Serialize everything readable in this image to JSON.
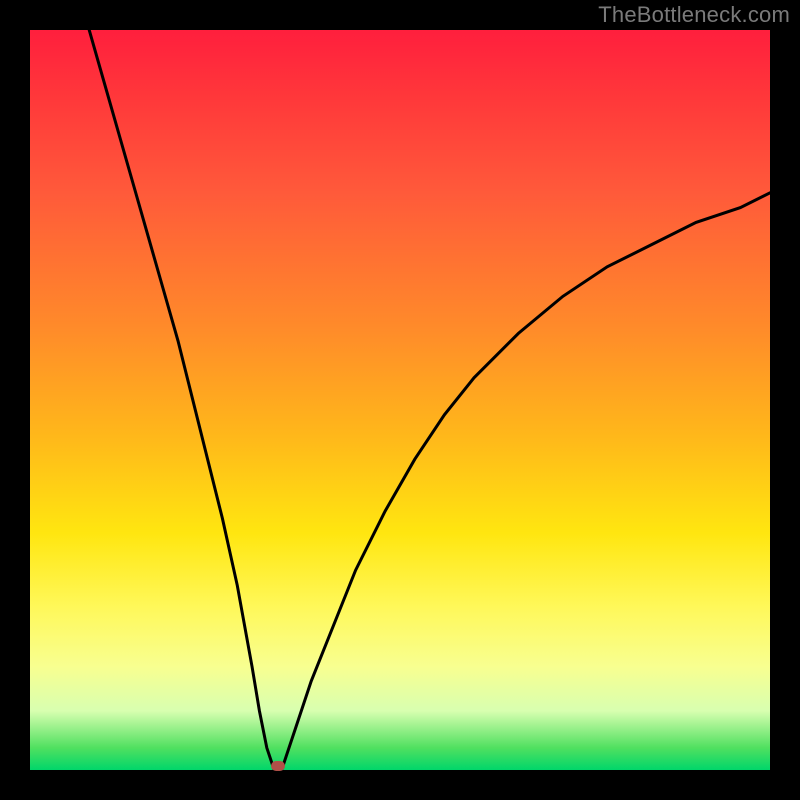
{
  "attribution": "TheBottleneck.com",
  "colors": {
    "frame": "#000000",
    "gradient_top": "#ff1f3d",
    "gradient_bottom": "#00d66a",
    "curve": "#000000",
    "marker": "#b05048"
  },
  "chart_data": {
    "type": "line",
    "title": "",
    "xlabel": "",
    "ylabel": "",
    "xlim": [
      0,
      100
    ],
    "ylim": [
      0,
      100
    ],
    "grid": false,
    "legend": false,
    "series": [
      {
        "name": "left-branch",
        "x": [
          8,
          10,
          12,
          14,
          16,
          18,
          20,
          22,
          24,
          26,
          28,
          30,
          31,
          32,
          33
        ],
        "y": [
          100,
          93,
          86,
          79,
          72,
          65,
          58,
          50,
          42,
          34,
          25,
          14,
          8,
          3,
          0
        ]
      },
      {
        "name": "right-branch",
        "x": [
          34,
          36,
          38,
          40,
          44,
          48,
          52,
          56,
          60,
          66,
          72,
          78,
          84,
          90,
          96,
          100
        ],
        "y": [
          0,
          6,
          12,
          17,
          27,
          35,
          42,
          48,
          53,
          59,
          64,
          68,
          71,
          74,
          76,
          78
        ]
      }
    ],
    "marker": {
      "x": 33.5,
      "y": 0.5
    }
  }
}
